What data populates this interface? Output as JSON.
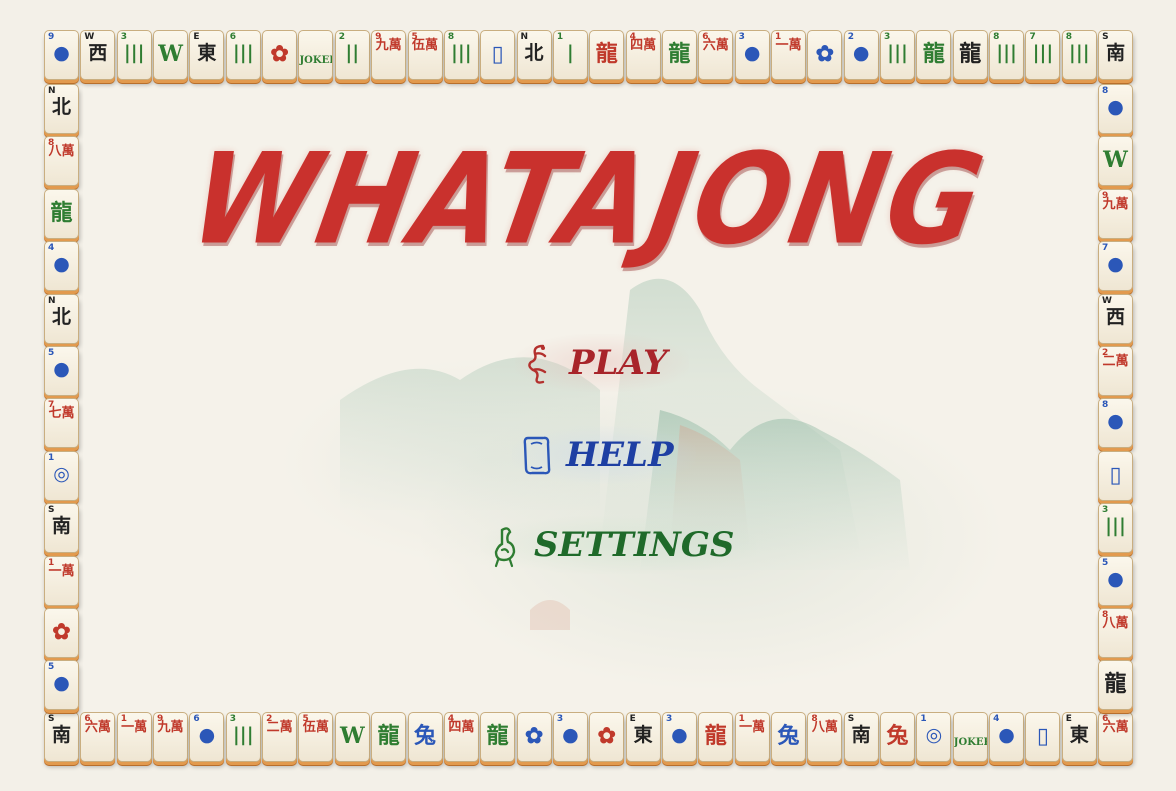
{
  "game": {
    "title": "WHATAJONG",
    "menu": [
      {
        "label": "PLAY",
        "icon": "dragon-icon",
        "color": "#a8242a",
        "bg": "rgba(230,190,185,0.45)"
      },
      {
        "label": "HELP",
        "icon": "flower-frame-icon",
        "color": "#1e3fa3",
        "bg": "rgba(200,215,235,0.45)"
      },
      {
        "label": "SETTINGS",
        "icon": "green-dragon-icon",
        "color": "#1f6a2a",
        "bg": "rgba(205,225,205,0.5)"
      }
    ]
  },
  "colors": {
    "red": "#c0392b",
    "blue": "#2b57b8",
    "green": "#2f7d32",
    "black": "#222222",
    "accent": "#c9312d"
  },
  "tiles": {
    "top": [
      {
        "n": "9",
        "g": "●",
        "c": "blue",
        "k": "dots"
      },
      {
        "n": "W",
        "g": "西",
        "c": "black"
      },
      {
        "n": "3",
        "g": "|||",
        "c": "green",
        "k": "bam"
      },
      {
        "n": "",
        "g": "W",
        "c": "green",
        "k": "bam"
      },
      {
        "n": "E",
        "g": "東",
        "c": "black"
      },
      {
        "n": "6",
        "g": "|||",
        "c": "green",
        "k": "bam"
      },
      {
        "n": "",
        "g": "✿",
        "c": "red"
      },
      {
        "n": "",
        "g": "JOKER",
        "c": "green",
        "k": "joker"
      },
      {
        "n": "2",
        "g": "||",
        "c": "green",
        "k": "bam"
      },
      {
        "n": "9",
        "g": "九萬",
        "c": "red",
        "k": "char"
      },
      {
        "n": "5",
        "g": "伍萬",
        "c": "red",
        "k": "char"
      },
      {
        "n": "8",
        "g": "|||",
        "c": "green",
        "k": "bam"
      },
      {
        "n": "",
        "g": "▯",
        "c": "blue"
      },
      {
        "n": "N",
        "g": "北",
        "c": "black"
      },
      {
        "n": "1",
        "g": "|",
        "c": "green",
        "k": "bam"
      },
      {
        "n": "",
        "g": "龍",
        "c": "red"
      },
      {
        "n": "4",
        "g": "四萬",
        "c": "red",
        "k": "char"
      },
      {
        "n": "",
        "g": "龍",
        "c": "green"
      },
      {
        "n": "6",
        "g": "六萬",
        "c": "red",
        "k": "char"
      },
      {
        "n": "3",
        "g": "●",
        "c": "blue",
        "k": "dots"
      },
      {
        "n": "1",
        "g": "一萬",
        "c": "red",
        "k": "char"
      },
      {
        "n": "",
        "g": "✿",
        "c": "blue"
      },
      {
        "n": "2",
        "g": "●",
        "c": "blue",
        "k": "dots"
      },
      {
        "n": "3",
        "g": "|||",
        "c": "green",
        "k": "bam"
      },
      {
        "n": "",
        "g": "龍",
        "c": "green"
      },
      {
        "n": "",
        "g": "龍",
        "c": "black"
      },
      {
        "n": "8",
        "g": "|||",
        "c": "green",
        "k": "bam"
      },
      {
        "n": "7",
        "g": "|||",
        "c": "green",
        "k": "bam"
      },
      {
        "n": "8",
        "g": "|||",
        "c": "green",
        "k": "bam"
      },
      {
        "n": "S",
        "g": "南",
        "c": "black"
      }
    ],
    "left": [
      {
        "n": "N",
        "g": "北",
        "c": "black"
      },
      {
        "n": "8",
        "g": "八萬",
        "c": "red",
        "k": "char"
      },
      {
        "n": "",
        "g": "龍",
        "c": "green"
      },
      {
        "n": "4",
        "g": "●",
        "c": "blue",
        "k": "dots"
      },
      {
        "n": "N",
        "g": "北",
        "c": "black"
      },
      {
        "n": "5",
        "g": "●",
        "c": "blue",
        "k": "dots"
      },
      {
        "n": "7",
        "g": "七萬",
        "c": "red",
        "k": "char"
      },
      {
        "n": "1",
        "g": "◎",
        "c": "blue"
      },
      {
        "n": "S",
        "g": "南",
        "c": "black"
      },
      {
        "n": "1",
        "g": "一萬",
        "c": "red",
        "k": "char"
      },
      {
        "n": "",
        "g": "✿",
        "c": "red"
      },
      {
        "n": "5",
        "g": "●",
        "c": "blue",
        "k": "dots"
      }
    ],
    "right": [
      {
        "n": "8",
        "g": "●",
        "c": "blue",
        "k": "dots"
      },
      {
        "n": "",
        "g": "W",
        "c": "green",
        "k": "bam"
      },
      {
        "n": "9",
        "g": "九萬",
        "c": "red",
        "k": "char"
      },
      {
        "n": "7",
        "g": "●",
        "c": "blue",
        "k": "dots"
      },
      {
        "n": "W",
        "g": "西",
        "c": "black"
      },
      {
        "n": "2",
        "g": "二萬",
        "c": "red",
        "k": "char"
      },
      {
        "n": "8",
        "g": "●",
        "c": "blue",
        "k": "dots"
      },
      {
        "n": "",
        "g": "▯",
        "c": "blue"
      },
      {
        "n": "3",
        "g": "|||",
        "c": "green",
        "k": "bam"
      },
      {
        "n": "5",
        "g": "●",
        "c": "blue",
        "k": "dots"
      },
      {
        "n": "8",
        "g": "八萬",
        "c": "red",
        "k": "char"
      },
      {
        "n": "",
        "g": "龍",
        "c": "black"
      }
    ],
    "bottom": [
      {
        "n": "S",
        "g": "南",
        "c": "black"
      },
      {
        "n": "6",
        "g": "六萬",
        "c": "red",
        "k": "char"
      },
      {
        "n": "1",
        "g": "一萬",
        "c": "red",
        "k": "char"
      },
      {
        "n": "9",
        "g": "九萬",
        "c": "red",
        "k": "char"
      },
      {
        "n": "6",
        "g": "●",
        "c": "blue",
        "k": "dots"
      },
      {
        "n": "3",
        "g": "|||",
        "c": "green",
        "k": "bam"
      },
      {
        "n": "2",
        "g": "二萬",
        "c": "red",
        "k": "char"
      },
      {
        "n": "5",
        "g": "伍萬",
        "c": "red",
        "k": "char"
      },
      {
        "n": "",
        "g": "W",
        "c": "green",
        "k": "bam"
      },
      {
        "n": "",
        "g": "龍",
        "c": "green"
      },
      {
        "n": "",
        "g": "兔",
        "c": "blue"
      },
      {
        "n": "4",
        "g": "四萬",
        "c": "red",
        "k": "char"
      },
      {
        "n": "",
        "g": "龍",
        "c": "green"
      },
      {
        "n": "",
        "g": "✿",
        "c": "blue"
      },
      {
        "n": "3",
        "g": "●",
        "c": "blue",
        "k": "dots"
      },
      {
        "n": "",
        "g": "✿",
        "c": "red"
      },
      {
        "n": "E",
        "g": "東",
        "c": "black"
      },
      {
        "n": "3",
        "g": "●",
        "c": "blue",
        "k": "dots"
      },
      {
        "n": "",
        "g": "龍",
        "c": "red"
      },
      {
        "n": "1",
        "g": "一萬",
        "c": "red",
        "k": "char"
      },
      {
        "n": "",
        "g": "兔",
        "c": "blue"
      },
      {
        "n": "8",
        "g": "八萬",
        "c": "red",
        "k": "char"
      },
      {
        "n": "S",
        "g": "南",
        "c": "black"
      },
      {
        "n": "",
        "g": "兔",
        "c": "red"
      },
      {
        "n": "1",
        "g": "◎",
        "c": "blue"
      },
      {
        "n": "",
        "g": "JOKER",
        "c": "green",
        "k": "joker"
      },
      {
        "n": "4",
        "g": "●",
        "c": "blue",
        "k": "dots"
      },
      {
        "n": "",
        "g": "▯",
        "c": "blue"
      },
      {
        "n": "E",
        "g": "東",
        "c": "black"
      },
      {
        "n": "6",
        "g": "六萬",
        "c": "red",
        "k": "char"
      }
    ]
  }
}
